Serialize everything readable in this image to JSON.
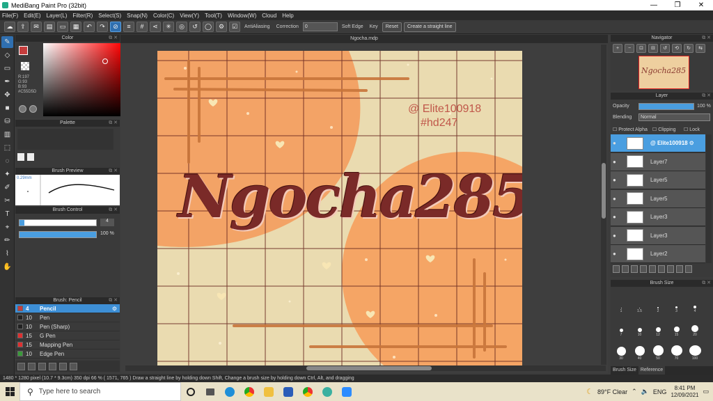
{
  "window": {
    "title": "MediBang Paint Pro (32bit)",
    "buttons": [
      "—",
      "❐",
      "✕"
    ]
  },
  "menu": [
    "File(F)",
    "Edit(E)",
    "Layer(L)",
    "Filter(R)",
    "Select(S)",
    "Snap(N)",
    "Color(C)",
    "View(Y)",
    "Tool(T)",
    "Window(W)",
    "Cloud",
    "Help"
  ],
  "toolbar": {
    "antialias_label": "AntiAliasing",
    "correction_label": "Correction",
    "correction_value": "0",
    "softedge_label": "Soft Edge",
    "key_label": "Key",
    "reset_label": "Reset",
    "straight_line_label": "Create a straight line"
  },
  "color_panel": {
    "title": "Color",
    "rgb_text": "R:197\nG:93\nB:93",
    "hex_text": "#C55D5D",
    "fg_color": "#c55d5d"
  },
  "palette_panel": {
    "title": "Palette"
  },
  "brush_preview": {
    "title": "Brush Preview",
    "size_text": "0.29mm"
  },
  "brush_control": {
    "title": "Brush Control",
    "size_value": "4",
    "opacity_value": "100 %"
  },
  "brush_list": {
    "title": "Brush: Pencil",
    "items": [
      {
        "size": "4",
        "name": "Pencil",
        "color": "#c53d3d",
        "selected": true
      },
      {
        "size": "10",
        "name": "Pen",
        "color": "#222222"
      },
      {
        "size": "10",
        "name": "Pen (Sharp)",
        "color": "#222222"
      },
      {
        "size": "15",
        "name": "G Pen",
        "color": "#e03030"
      },
      {
        "size": "15",
        "name": "Mapping Pen",
        "color": "#e03030"
      },
      {
        "size": "10",
        "name": "Edge Pen",
        "color": "#3a9a3a"
      }
    ]
  },
  "document": {
    "tab_title": "Ngocha.mdp",
    "title_text": "Ngocha285",
    "credit_line1": "@ Elite100918",
    "credit_line2": "#hd247"
  },
  "navigator": {
    "title": "Navigator",
    "thumb_text": "Ngocha285"
  },
  "layer_panel": {
    "title": "Layer",
    "opacity_label": "Opacity",
    "opacity_value": "100 %",
    "blending_label": "Blending",
    "blending_value": "Normal",
    "protect_alpha": "Protect Alpha",
    "clipping": "Clipping",
    "lock": "Lock",
    "layers": [
      {
        "name": "@ Elite100918",
        "selected": true
      },
      {
        "name": "Layer7"
      },
      {
        "name": "Layer5"
      },
      {
        "name": "Layer5"
      },
      {
        "name": "Layer3"
      },
      {
        "name": "Layer3"
      },
      {
        "name": "Layer2"
      }
    ]
  },
  "brush_size_panel": {
    "title": "Brush Size",
    "tabs": [
      "Brush Size",
      "Reference"
    ],
    "sizes": [
      "1",
      "1.5",
      "2",
      "3",
      "4",
      "7",
      "10",
      "12",
      "15",
      "20",
      "30",
      "40",
      "50",
      "70",
      "100"
    ]
  },
  "status_bar": {
    "text": "1480 * 1280 pixel   (10.7 * 9.3cm)   350 dpi   66 %   ( 1571, 765 )   Draw a straight line by holding down Shift, Change a brush size by holding down Ctrl, Alt, and dragging"
  },
  "taskbar": {
    "search_placeholder": "Type here to search",
    "weather": "89°F  Clear",
    "language": "ENG",
    "time": "8:41 PM",
    "date": "12/09/2021"
  }
}
